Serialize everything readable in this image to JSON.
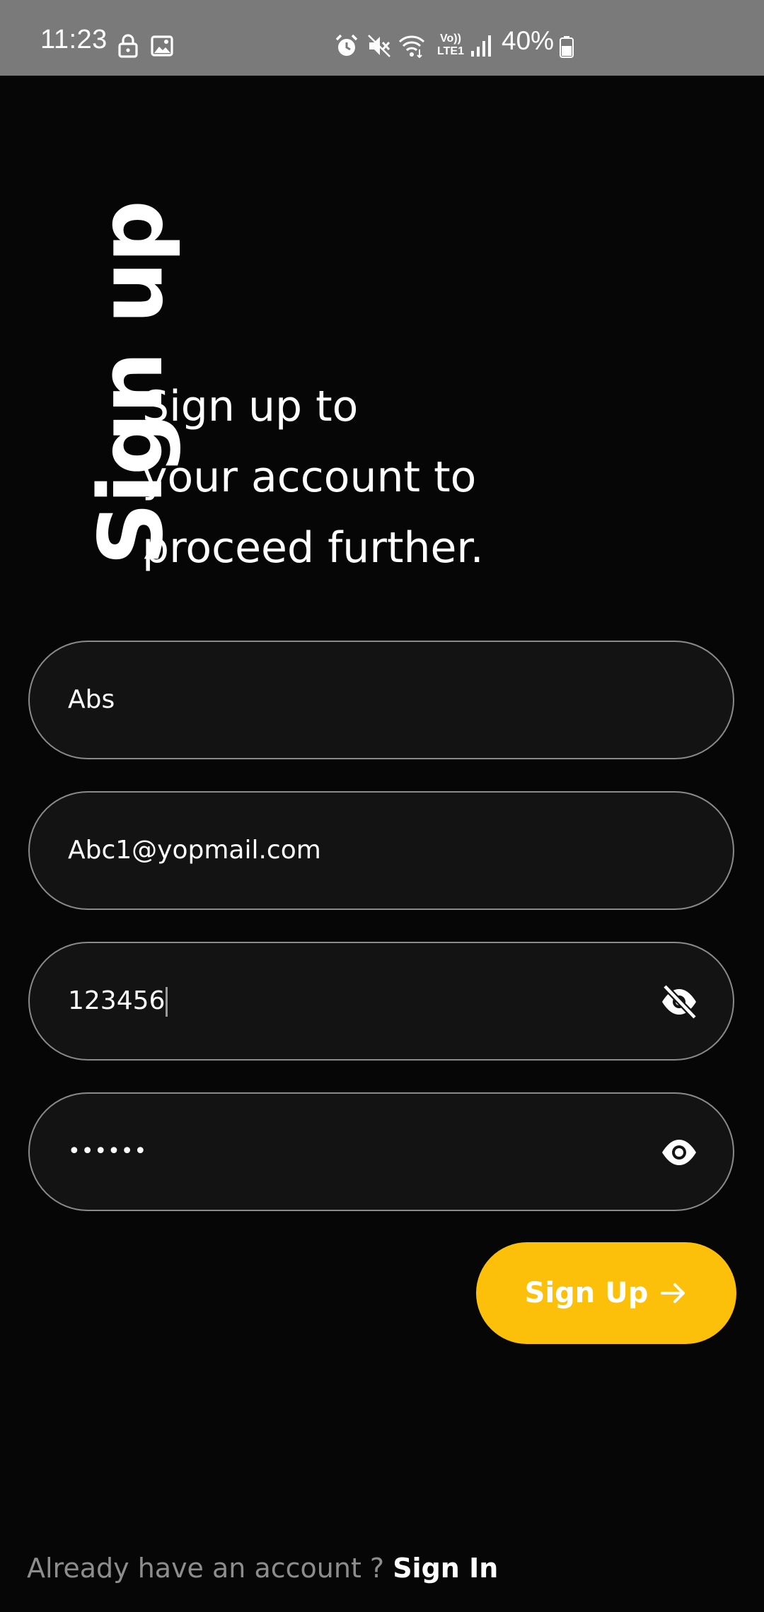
{
  "status_bar": {
    "time": "11:23",
    "battery": "40%",
    "icons": [
      "lock-icon",
      "image-icon",
      "alarm-icon",
      "mute-icon",
      "wifi-icon",
      "volte-icon",
      "signal-icon",
      "battery-icon"
    ],
    "volte_line1": "Vo))",
    "volte_line2": "LTE1"
  },
  "header": {
    "vertical_title": "Sign up",
    "subtitle_lines": [
      "Sign up to",
      "your account to",
      "proceed further."
    ]
  },
  "form": {
    "name_value": "Abs",
    "email_value": "Abc1@yopmail.com",
    "password_value": "123456",
    "password_toggle_icon": "eye-off-icon",
    "confirm_value": "••••••",
    "confirm_toggle_icon": "eye-icon",
    "submit_label": "Sign Up",
    "submit_icon": "arrow-right-icon"
  },
  "footer": {
    "prompt": "Already have an account ? ",
    "link": "Sign In"
  },
  "colors": {
    "background": "#060606",
    "status_bar": "#7a7a7a",
    "field_bg": "#131313",
    "field_border": "#8a8a8a",
    "accent": "#fcc00a",
    "muted_text": "#8d8d8d"
  }
}
